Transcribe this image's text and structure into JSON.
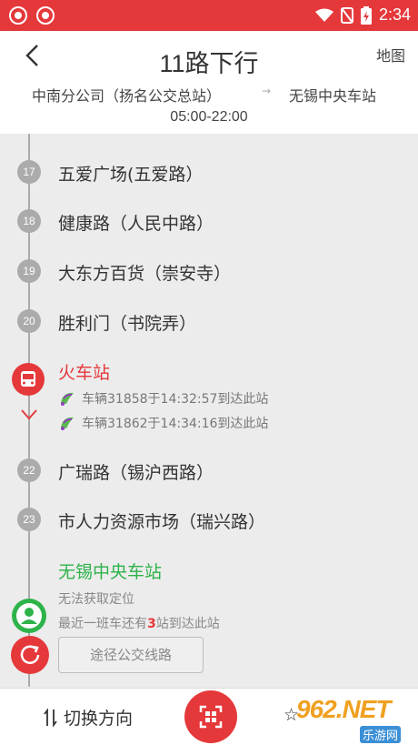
{
  "status_bar": {
    "time": "2:34",
    "icons": [
      "app-icon",
      "app-icon",
      "wifi-icon",
      "no-sim-icon",
      "battery-icon"
    ]
  },
  "header": {
    "title": "11路下行",
    "map_label": "地图",
    "route_from": "中南分公司（扬名公交总站）",
    "route_to": "无锡中央车站",
    "hours": "05:00-22:00"
  },
  "stops": [
    {
      "number": "17",
      "name": "五爱广场(五爱路）"
    },
    {
      "number": "18",
      "name": "健康路（人民中路）"
    },
    {
      "number": "19",
      "name": "大东方百货（崇安寺）"
    },
    {
      "number": "20",
      "name": "胜利门（书院弄）"
    }
  ],
  "current_stop": {
    "name": "火车站",
    "accent": "#e5383b",
    "vehicles": [
      "车辆31858于14:32:57到达此站",
      "车辆31862于14:34:16到达此站"
    ]
  },
  "stops_after": [
    {
      "number": "22",
      "name": "广瑞路（锡沪西路）"
    },
    {
      "number": "23",
      "name": "市人力资源市场（瑞兴路）"
    }
  ],
  "destination": {
    "name": "无锡中央车站",
    "color": "#2db34a",
    "no_location": "无法获取定位",
    "nearest_prefix": "最近一班车还有",
    "nearest_count": "3",
    "nearest_suffix": "站到达此站",
    "lines_button": "途径公交线路"
  },
  "bottom_bar": {
    "switch_direction": "切换方向",
    "favorite_glyph": "☆"
  },
  "watermark": {
    "main": "962.NET",
    "sub": "乐游网"
  }
}
